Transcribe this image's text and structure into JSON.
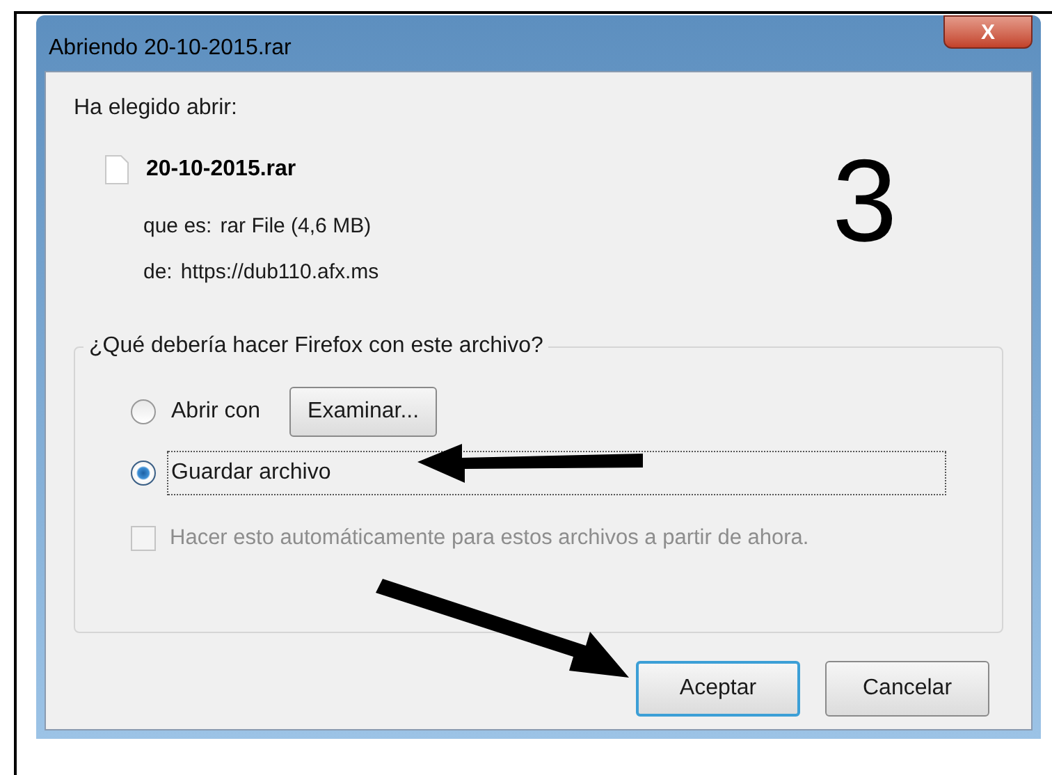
{
  "window": {
    "title": "Abriendo 20-10-2015.rar",
    "close": "X"
  },
  "intro": "Ha elegido abrir:",
  "file": {
    "name": "20-10-2015.rar",
    "type_label": "que es:",
    "type": "rar File (4,6 MB)",
    "source_label": "de:",
    "source": "https://dub110.afx.ms"
  },
  "step_number": "3",
  "action_group": {
    "legend": "¿Qué debería hacer Firefox con este archivo?",
    "options": [
      {
        "label": "Abrir con",
        "selected": false,
        "focused": false,
        "button": "Examinar..."
      },
      {
        "label": "Guardar archivo",
        "selected": true,
        "focused": true
      }
    ],
    "remember": {
      "label": "Hacer esto automáticamente para estos archivos a partir de ahora.",
      "checked": false,
      "disabled": true
    }
  },
  "buttons": [
    {
      "label": "Aceptar",
      "default": true
    },
    {
      "label": "Cancelar",
      "default": false
    }
  ],
  "annotation_arrows": [
    {
      "kind": "arrow"
    },
    {
      "kind": "arrow"
    }
  ]
}
